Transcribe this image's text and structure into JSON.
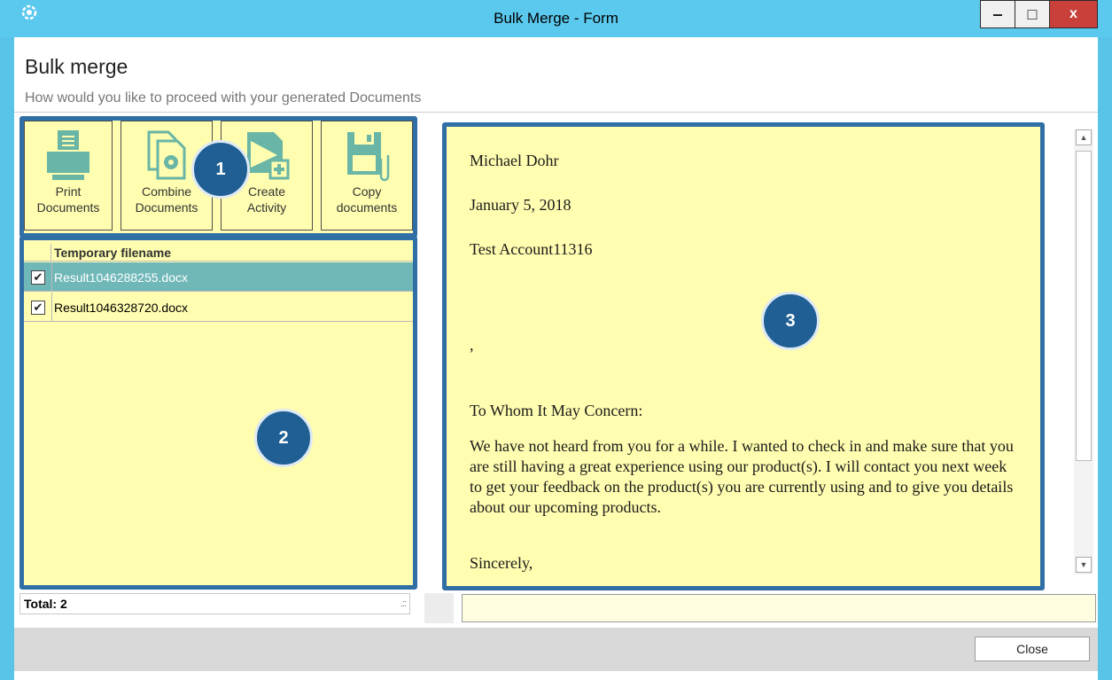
{
  "window": {
    "title": "Bulk Merge - Form",
    "minimize_glyph": "‒",
    "maximize_glyph": "□",
    "close_glyph": "x"
  },
  "header": {
    "title": "Bulk merge",
    "subtitle": "How would you like to proceed with your generated Documents"
  },
  "toolbar": {
    "buttons": [
      {
        "label_line1": "Print",
        "label_line2": "Documents",
        "icon": "printer-icon"
      },
      {
        "label_line1": "Combine",
        "label_line2": "Documents",
        "icon": "combine-documents-icon"
      },
      {
        "label_line1": "Create",
        "label_line2": "Activity",
        "icon": "create-activity-icon"
      },
      {
        "label_line1": "Copy",
        "label_line2": "documents",
        "icon": "copy-documents-icon"
      }
    ]
  },
  "grid": {
    "column_header": "Temporary filename",
    "rows": [
      {
        "filename": "Result1046288255.docx",
        "checked": true,
        "selected": true,
        "check_glyph": "✔"
      },
      {
        "filename": "Result1046328720.docx",
        "checked": true,
        "selected": false,
        "check_glyph": "✔"
      }
    ],
    "total_label": "Total: 2",
    "grip_glyph": ".:​:"
  },
  "preview": {
    "line_name": "Michael Dohr",
    "line_date": "January 5, 2018",
    "line_account": "Test Account11316",
    "line_comma": ",",
    "salutation": "To Whom It May Concern:",
    "body": "We have not heard from you for a while. I wanted to check in and make sure that you are still having a great experience using our product(s). I will contact you next week to get your feedback on the product(s) you are currently using and to give you details about our upcoming products.",
    "closing": "Sincerely,"
  },
  "scrollbar": {
    "up_glyph": "▲",
    "down_glyph": "▼"
  },
  "annotations": {
    "badge1": "1",
    "badge2": "2",
    "badge3": "3"
  },
  "footer": {
    "close_label": "Close"
  },
  "colors": {
    "titlebar": "#5bc8ee",
    "panel": "#fffdb0",
    "highlight_border": "#2f6fa6",
    "badge": "#1f5f93",
    "selected_row": "#70b8b8",
    "close_button": "#c9403a"
  }
}
